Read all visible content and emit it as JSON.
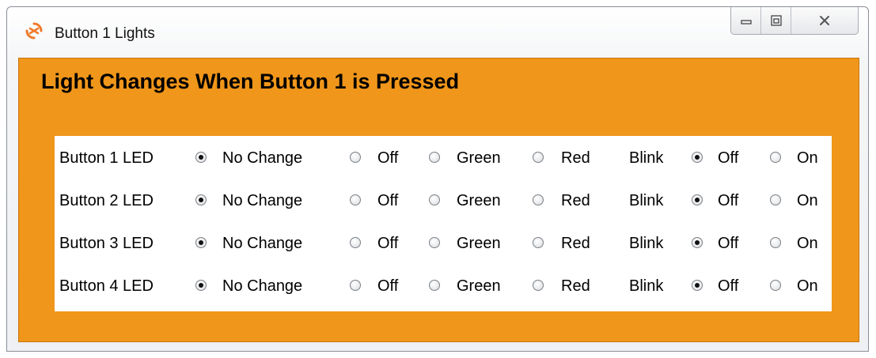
{
  "window": {
    "title": "Button 1 Lights",
    "app_icon": "swirl-logo-icon",
    "controls": [
      "minimize-icon",
      "restore-icon",
      "close-icon"
    ]
  },
  "heading": "Light Changes When Button 1 is Pressed",
  "colors": {
    "client_background": "#f0961a",
    "panel_background": "#ffffff",
    "app_icon": "#f07a2a"
  },
  "options": {
    "no_change": "No Change",
    "off": "Off",
    "green": "Green",
    "red": "Red",
    "blink": "Blink",
    "blink_off": "Off",
    "blink_on": "On"
  },
  "rows": [
    {
      "label": "Button 1 LED",
      "color_selected": "No Change",
      "blink_selected": "Off"
    },
    {
      "label": "Button 2 LED",
      "color_selected": "No Change",
      "blink_selected": "Off"
    },
    {
      "label": "Button 3 LED",
      "color_selected": "No Change",
      "blink_selected": "Off"
    },
    {
      "label": "Button 4 LED",
      "color_selected": "No Change",
      "blink_selected": "Off"
    }
  ]
}
